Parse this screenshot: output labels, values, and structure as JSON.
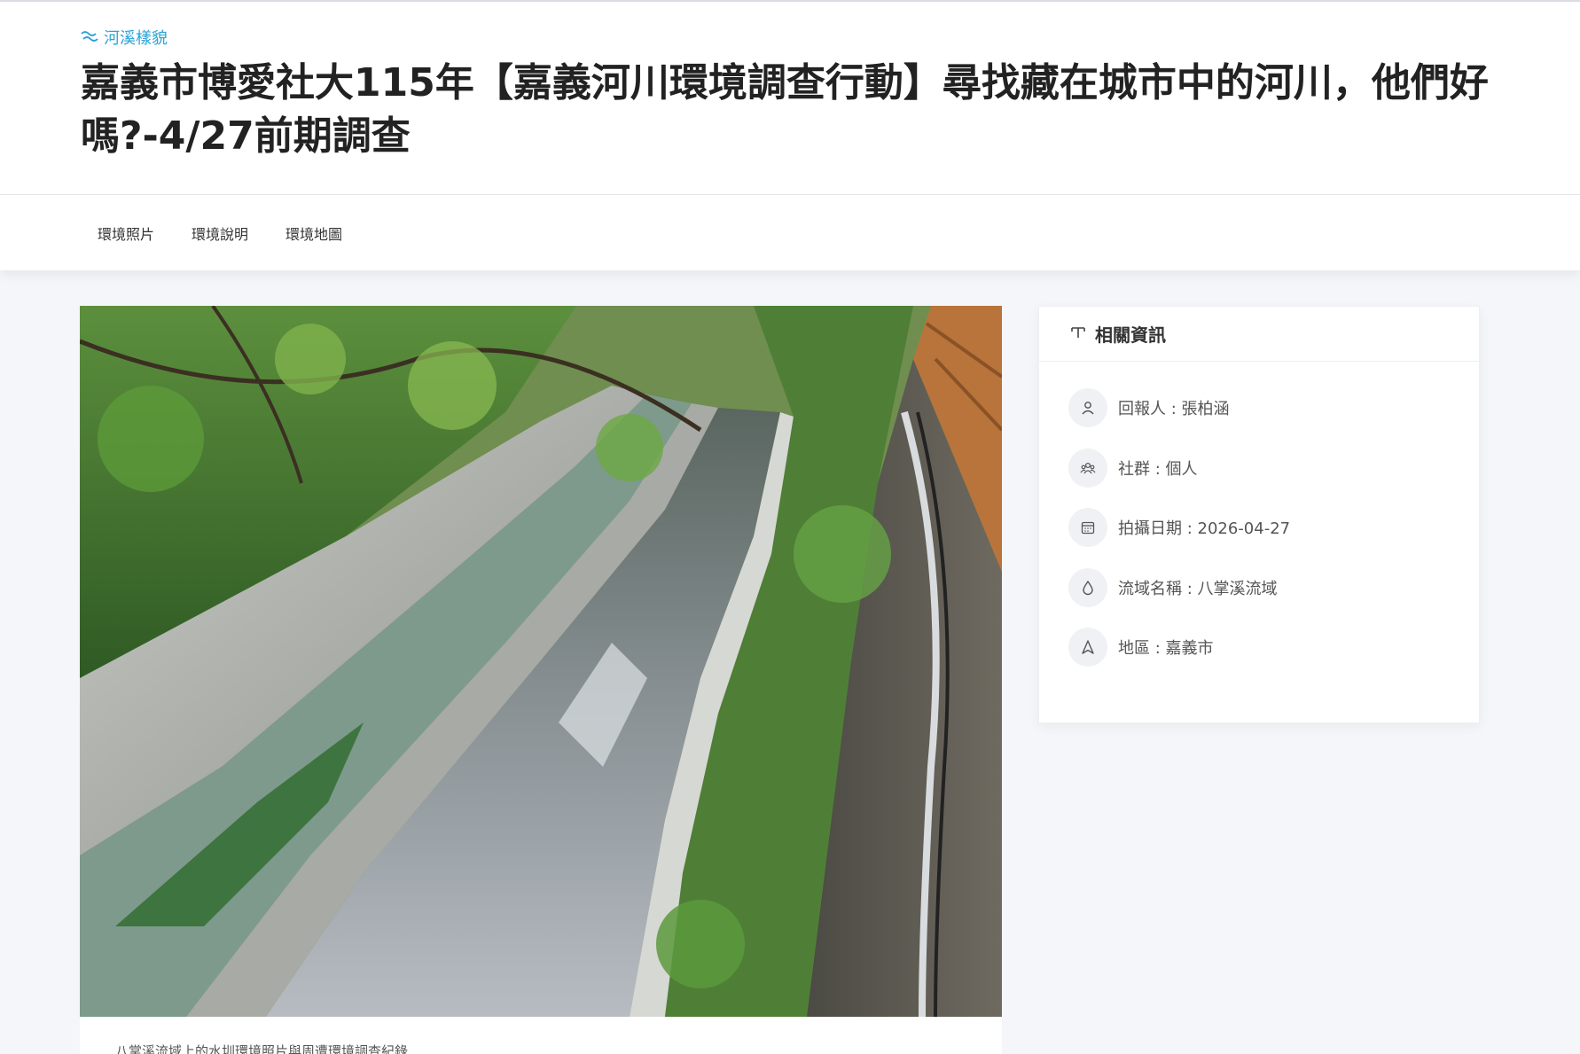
{
  "header": {
    "category": "河溪樣貌",
    "title": "嘉義市博愛社大115年【嘉義河川環境調查行動】尋找藏在城市中的河川，他們好嗎?-4/27前期調查"
  },
  "tabs": [
    {
      "label": "環境照片"
    },
    {
      "label": "環境說明"
    },
    {
      "label": "環境地圖"
    }
  ],
  "photo": {
    "caption": "八掌溪流域上的水圳環境照片與周遭環境調查紀錄"
  },
  "sidebar": {
    "heading": "相關資訊",
    "items": [
      {
        "icon": "user-icon",
        "label": "回報人 : 張柏涵"
      },
      {
        "icon": "group-icon",
        "label": "社群 : 個人"
      },
      {
        "icon": "calendar-icon",
        "label": "拍攝日期 : 2026-04-27"
      },
      {
        "icon": "water-drop-icon",
        "label": "流域名稱 : 八掌溪流域"
      },
      {
        "icon": "location-arrow-icon",
        "label": "地區 : 嘉義市"
      }
    ]
  },
  "colors": {
    "accent": "#2aa3d9",
    "background": "#f4f6fa"
  }
}
